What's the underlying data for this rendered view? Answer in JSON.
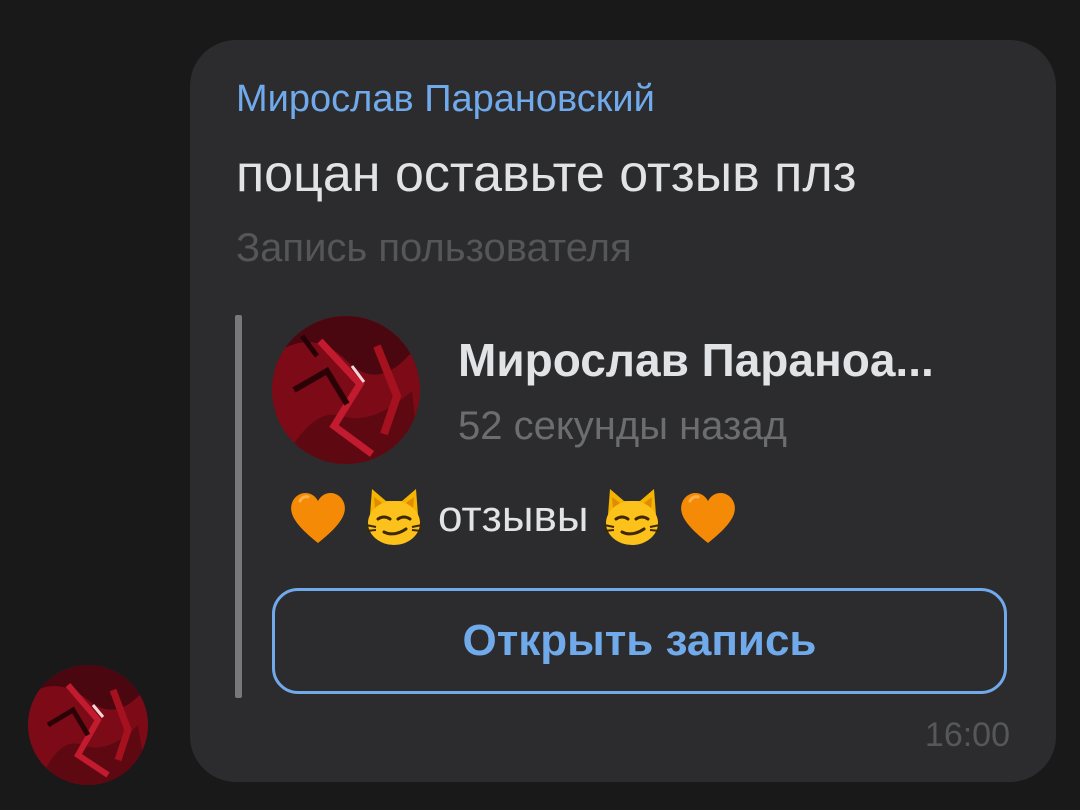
{
  "chat": {
    "message": {
      "sender_name": "Мирослав Парановский",
      "text": "поцан оставьте отзыв плз",
      "attachment_caption": "Запись пользователя",
      "time": "16:00"
    },
    "repost": {
      "author_name": "Мирослав Параноа...",
      "posted_ago": "52 секунды назад",
      "body_text": "отзывы",
      "body_icons": [
        "orange-heart-icon",
        "smirking-cat-icon",
        "smirking-cat-icon",
        "orange-heart-icon"
      ],
      "open_button_label": "Открыть запись"
    }
  },
  "colors": {
    "background": "#19191a",
    "bubble": "#2c2c2e",
    "accent": "#71aaeb",
    "text_primary": "#e1e3e6",
    "text_secondary": "#6b6d70",
    "avatar_red": "#8e0f1c"
  }
}
